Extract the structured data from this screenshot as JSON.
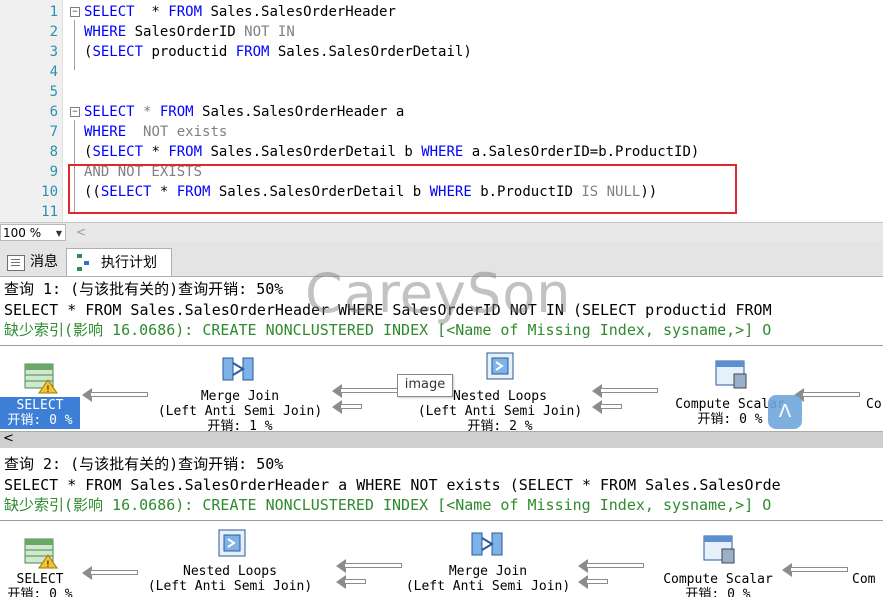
{
  "editor": {
    "lines": [
      {
        "num": "1",
        "parts": [
          [
            "kw",
            "SELECT"
          ],
          [
            "",
            "  * "
          ],
          [
            "kw",
            "FROM"
          ],
          [
            "",
            " Sales.SalesOrderHeader"
          ]
        ]
      },
      {
        "num": "2",
        "parts": [
          [
            "kw",
            "WHERE"
          ],
          [
            "",
            " SalesOrderID "
          ],
          [
            "gray",
            "NOT IN"
          ]
        ]
      },
      {
        "num": "3",
        "parts": [
          [
            "",
            "("
          ],
          [
            "kw",
            "SELECT"
          ],
          [
            "",
            " productid "
          ],
          [
            "kw",
            "FROM"
          ],
          [
            "",
            " Sales.SalesOrderDetail)"
          ]
        ]
      },
      {
        "num": "4",
        "parts": []
      },
      {
        "num": "5",
        "parts": []
      },
      {
        "num": "6",
        "parts": [
          [
            "kw",
            "SELECT"
          ],
          [
            "gray",
            " * "
          ],
          [
            "kw",
            "FROM"
          ],
          [
            "",
            " Sales.SalesOrderHeader a"
          ]
        ]
      },
      {
        "num": "7",
        "parts": [
          [
            "kw",
            "WHERE"
          ],
          [
            "",
            "  "
          ],
          [
            "gray",
            "NOT exists"
          ]
        ]
      },
      {
        "num": "8",
        "parts": [
          [
            "",
            "("
          ],
          [
            "kw",
            "SELECT"
          ],
          [
            "",
            " * "
          ],
          [
            "kw",
            "FROM"
          ],
          [
            "",
            " Sales.SalesOrderDetail b "
          ],
          [
            "kw",
            "WHERE"
          ],
          [
            "",
            " a.SalesOrderID=b.ProductID)"
          ]
        ]
      },
      {
        "num": "9",
        "parts": [
          [
            "gray",
            "AND NOT EXISTS"
          ]
        ]
      },
      {
        "num": "10",
        "parts": [
          [
            "",
            "(("
          ],
          [
            "kw",
            "SELECT"
          ],
          [
            "",
            " * "
          ],
          [
            "kw",
            "FROM"
          ],
          [
            "",
            " Sales.SalesOrderDetail b "
          ],
          [
            "kw",
            "WHERE"
          ],
          [
            "",
            " b.ProductID "
          ],
          [
            "gray",
            "IS NULL"
          ],
          [
            "",
            "))"
          ]
        ]
      },
      {
        "num": "11",
        "parts": []
      }
    ]
  },
  "zoom": {
    "value": "100 %"
  },
  "tabs": {
    "messages": "消息",
    "plan": "执行计划"
  },
  "query1": {
    "title": "查询 1: (与该批有关的)查询开销: 50%",
    "sql": "SELECT * FROM Sales.SalesOrderHeader WHERE SalesOrderID NOT IN (SELECT productid FROM",
    "missing": "缺少索引(影响 16.0686): CREATE NONCLUSTERED INDEX [<Name of Missing Index, sysname,>] O",
    "ops": {
      "select": {
        "name": "SELECT",
        "cost": "开销: 0 %"
      },
      "merge": {
        "name": "Merge Join",
        "sub": "(Left Anti Semi Join)",
        "cost": "开销: 1 %"
      },
      "nested": {
        "name": "Nested Loops",
        "sub": "(Left Anti Semi Join)",
        "cost": "开销: 2 %"
      },
      "compute": {
        "name": "Compute Scalar",
        "cost": "开销: 0 %"
      },
      "cut": {
        "name": "Co"
      }
    }
  },
  "query2": {
    "title": "查询 2: (与该批有关的)查询开销: 50%",
    "sql": "SELECT * FROM Sales.SalesOrderHeader a WHERE NOT exists (SELECT * FROM Sales.SalesOrde",
    "missing": "缺少索引(影响 16.0686): CREATE NONCLUSTERED INDEX [<Name of Missing Index, sysname,>] O",
    "ops": {
      "select": {
        "name": "SELECT",
        "cost": "开销: 0 %"
      },
      "nested": {
        "name": "Nested Loops",
        "sub": "(Left Anti Semi Join)"
      },
      "merge": {
        "name": "Merge Join",
        "sub": "(Left Anti Semi Join)"
      },
      "compute": {
        "name": "Compute Scalar",
        "cost": "开销: 0 %"
      },
      "cut": {
        "name": "Com"
      }
    }
  },
  "tooltip": "image",
  "watermark": "CareySon",
  "floatbtn": "ⴷ",
  "colors": {
    "keyword": "#0000ff",
    "linenum": "#2b91af",
    "highlight_box": "#e0262f",
    "missing_index": "#2e8b2e",
    "selected_op": "#3d7fd6"
  }
}
